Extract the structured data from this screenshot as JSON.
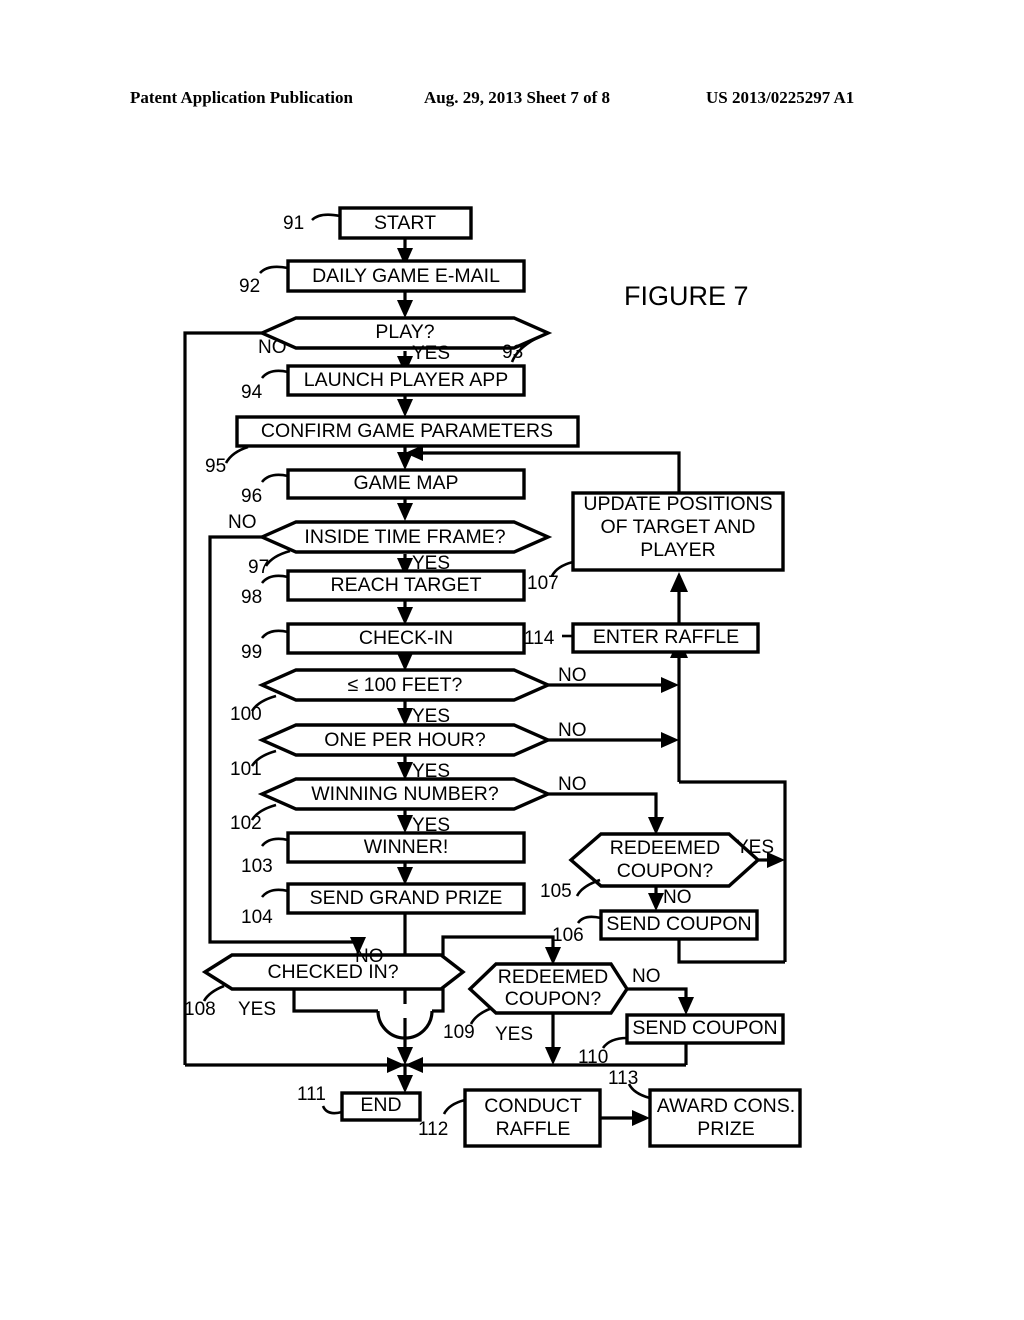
{
  "header": {
    "publication": "Patent Application Publication",
    "date_sheet": "Aug. 29, 2013  Sheet 7 of 8",
    "patent_number": "US 2013/0225297 A1"
  },
  "figure": {
    "title": "FIGURE 7"
  },
  "chart_data": {
    "type": "diagram",
    "title": "FIGURE 7",
    "nodes": [
      {
        "ref": "91",
        "label": "START",
        "shape": "process"
      },
      {
        "ref": "92",
        "label": "DAILY GAME E-MAIL",
        "shape": "process"
      },
      {
        "ref": "93",
        "label": "PLAY?",
        "shape": "decision"
      },
      {
        "ref": "94",
        "label": "LAUNCH PLAYER APP",
        "shape": "process"
      },
      {
        "ref": "95",
        "label": "CONFIRM GAME PARAMETERS",
        "shape": "process"
      },
      {
        "ref": "96",
        "label": "GAME MAP",
        "shape": "process"
      },
      {
        "ref": "97",
        "label": "INSIDE TIME FRAME?",
        "shape": "decision"
      },
      {
        "ref": "98",
        "label": "REACH TARGET",
        "shape": "process"
      },
      {
        "ref": "99",
        "label": "CHECK-IN",
        "shape": "process"
      },
      {
        "ref": "100",
        "label": "≤ 100 FEET?",
        "shape": "decision"
      },
      {
        "ref": "101",
        "label": "ONE PER HOUR?",
        "shape": "decision"
      },
      {
        "ref": "102",
        "label": "WINNING NUMBER?",
        "shape": "decision"
      },
      {
        "ref": "103",
        "label": "WINNER!",
        "shape": "process"
      },
      {
        "ref": "104",
        "label": "SEND GRAND PRIZE",
        "shape": "process"
      },
      {
        "ref": "105",
        "label": "REDEEMED COUPON?",
        "shape": "decision"
      },
      {
        "ref": "106",
        "label": "SEND COUPON",
        "shape": "process"
      },
      {
        "ref": "107",
        "label": "UPDATE POSITIONS OF TARGET AND PLAYER",
        "shape": "process"
      },
      {
        "ref": "108",
        "label": "CHECKED IN?",
        "shape": "decision"
      },
      {
        "ref": "109",
        "label": "REDEEMED COUPON?",
        "shape": "decision"
      },
      {
        "ref": "110",
        "label": "SEND COUPON",
        "shape": "process"
      },
      {
        "ref": "111",
        "label": "END",
        "shape": "process"
      },
      {
        "ref": "112",
        "label": "CONDUCT RAFFLE",
        "shape": "process"
      },
      {
        "ref": "113",
        "label": "AWARD CONS. PRIZE",
        "shape": "process"
      },
      {
        "ref": "114",
        "label": "ENTER RAFFLE",
        "shape": "process"
      }
    ],
    "edges": [
      {
        "from": "91",
        "to": "92",
        "label": ""
      },
      {
        "from": "92",
        "to": "93",
        "label": ""
      },
      {
        "from": "93",
        "to": "94",
        "label": "YES"
      },
      {
        "from": "93",
        "to": "111",
        "label": "NO"
      },
      {
        "from": "94",
        "to": "95",
        "label": ""
      },
      {
        "from": "95",
        "to": "96",
        "label": ""
      },
      {
        "from": "96",
        "to": "97",
        "label": ""
      },
      {
        "from": "97",
        "to": "98",
        "label": "YES"
      },
      {
        "from": "97",
        "to": "108",
        "label": "NO"
      },
      {
        "from": "98",
        "to": "99",
        "label": ""
      },
      {
        "from": "99",
        "to": "100",
        "label": ""
      },
      {
        "from": "100",
        "to": "101",
        "label": "YES"
      },
      {
        "from": "100",
        "to": "107",
        "label": "NO"
      },
      {
        "from": "101",
        "to": "102",
        "label": "YES"
      },
      {
        "from": "101",
        "to": "107",
        "label": "NO"
      },
      {
        "from": "102",
        "to": "103",
        "label": "YES"
      },
      {
        "from": "102",
        "to": "105",
        "label": "NO"
      },
      {
        "from": "103",
        "to": "104",
        "label": ""
      },
      {
        "from": "104",
        "to": "111",
        "label": ""
      },
      {
        "from": "105",
        "to": "107",
        "label": "YES"
      },
      {
        "from": "105",
        "to": "106",
        "label": "NO"
      },
      {
        "from": "106",
        "to": "107",
        "label": ""
      },
      {
        "from": "107",
        "to": "96",
        "label": ""
      },
      {
        "from": "114",
        "to": "107",
        "label": ""
      },
      {
        "from": "108",
        "to": "111",
        "label": "NO"
      },
      {
        "from": "108",
        "to": "109",
        "label": "YES"
      },
      {
        "from": "109",
        "to": "111",
        "label": "YES"
      },
      {
        "from": "109",
        "to": "110",
        "label": "NO"
      },
      {
        "from": "110",
        "to": "111",
        "label": ""
      },
      {
        "from": "112",
        "to": "113",
        "label": ""
      }
    ]
  },
  "nodes": {
    "n91": {
      "label": "START",
      "ref": "91"
    },
    "n92": {
      "label": "DAILY GAME E-MAIL",
      "ref": "92"
    },
    "n93": {
      "label": "PLAY?",
      "ref": "93"
    },
    "n94": {
      "label": "LAUNCH PLAYER APP",
      "ref": "94"
    },
    "n95": {
      "label": "CONFIRM GAME PARAMETERS",
      "ref": "95"
    },
    "n96": {
      "label": "GAME MAP",
      "ref": "96"
    },
    "n97": {
      "label": "INSIDE TIME FRAME?",
      "ref": "97"
    },
    "n98": {
      "label": "REACH TARGET",
      "ref": "98"
    },
    "n99": {
      "label": "CHECK-IN",
      "ref": "99"
    },
    "n100": {
      "label": "≤ 100 FEET?",
      "ref": "100"
    },
    "n101": {
      "label": "ONE PER HOUR?",
      "ref": "101"
    },
    "n102": {
      "label": "WINNING NUMBER?",
      "ref": "102"
    },
    "n103": {
      "label": "WINNER!",
      "ref": "103"
    },
    "n104": {
      "label": "SEND GRAND PRIZE",
      "ref": "104"
    },
    "n105": {
      "label_1": "REDEEMED",
      "label_2": "COUPON?",
      "ref": "105"
    },
    "n106": {
      "label": "SEND COUPON",
      "ref": "106"
    },
    "n107": {
      "label_1": "UPDATE POSITIONS",
      "label_2": "OF TARGET AND",
      "label_3": "PLAYER",
      "ref": "107"
    },
    "n108": {
      "label": "CHECKED IN?",
      "ref": "108"
    },
    "n109": {
      "label_1": "REDEEMED",
      "label_2": "COUPON?",
      "ref": "109"
    },
    "n110": {
      "label": "SEND COUPON",
      "ref": "110"
    },
    "n111": {
      "label": "END",
      "ref": "111"
    },
    "n112": {
      "label_1": "CONDUCT",
      "label_2": "RAFFLE",
      "ref": "112"
    },
    "n113": {
      "label_1": "AWARD CONS.",
      "label_2": "PRIZE",
      "ref": "113"
    },
    "n114": {
      "label": "ENTER RAFFLE",
      "ref": "114"
    }
  },
  "edge_labels": {
    "play_no": "NO",
    "play_yes": "YES",
    "timeframe_no": "NO",
    "timeframe_yes": "YES",
    "feet_no": "NO",
    "feet_yes": "YES",
    "hour_no": "NO",
    "hour_yes": "YES",
    "winnum_no": "NO",
    "winnum_yes": "YES",
    "redeem105_yes": "YES",
    "redeem105_no": "NO",
    "checkedin_no": "NO",
    "checkedin_yes": "YES",
    "redeem109_no": "NO",
    "redeem109_yes": "YES"
  }
}
